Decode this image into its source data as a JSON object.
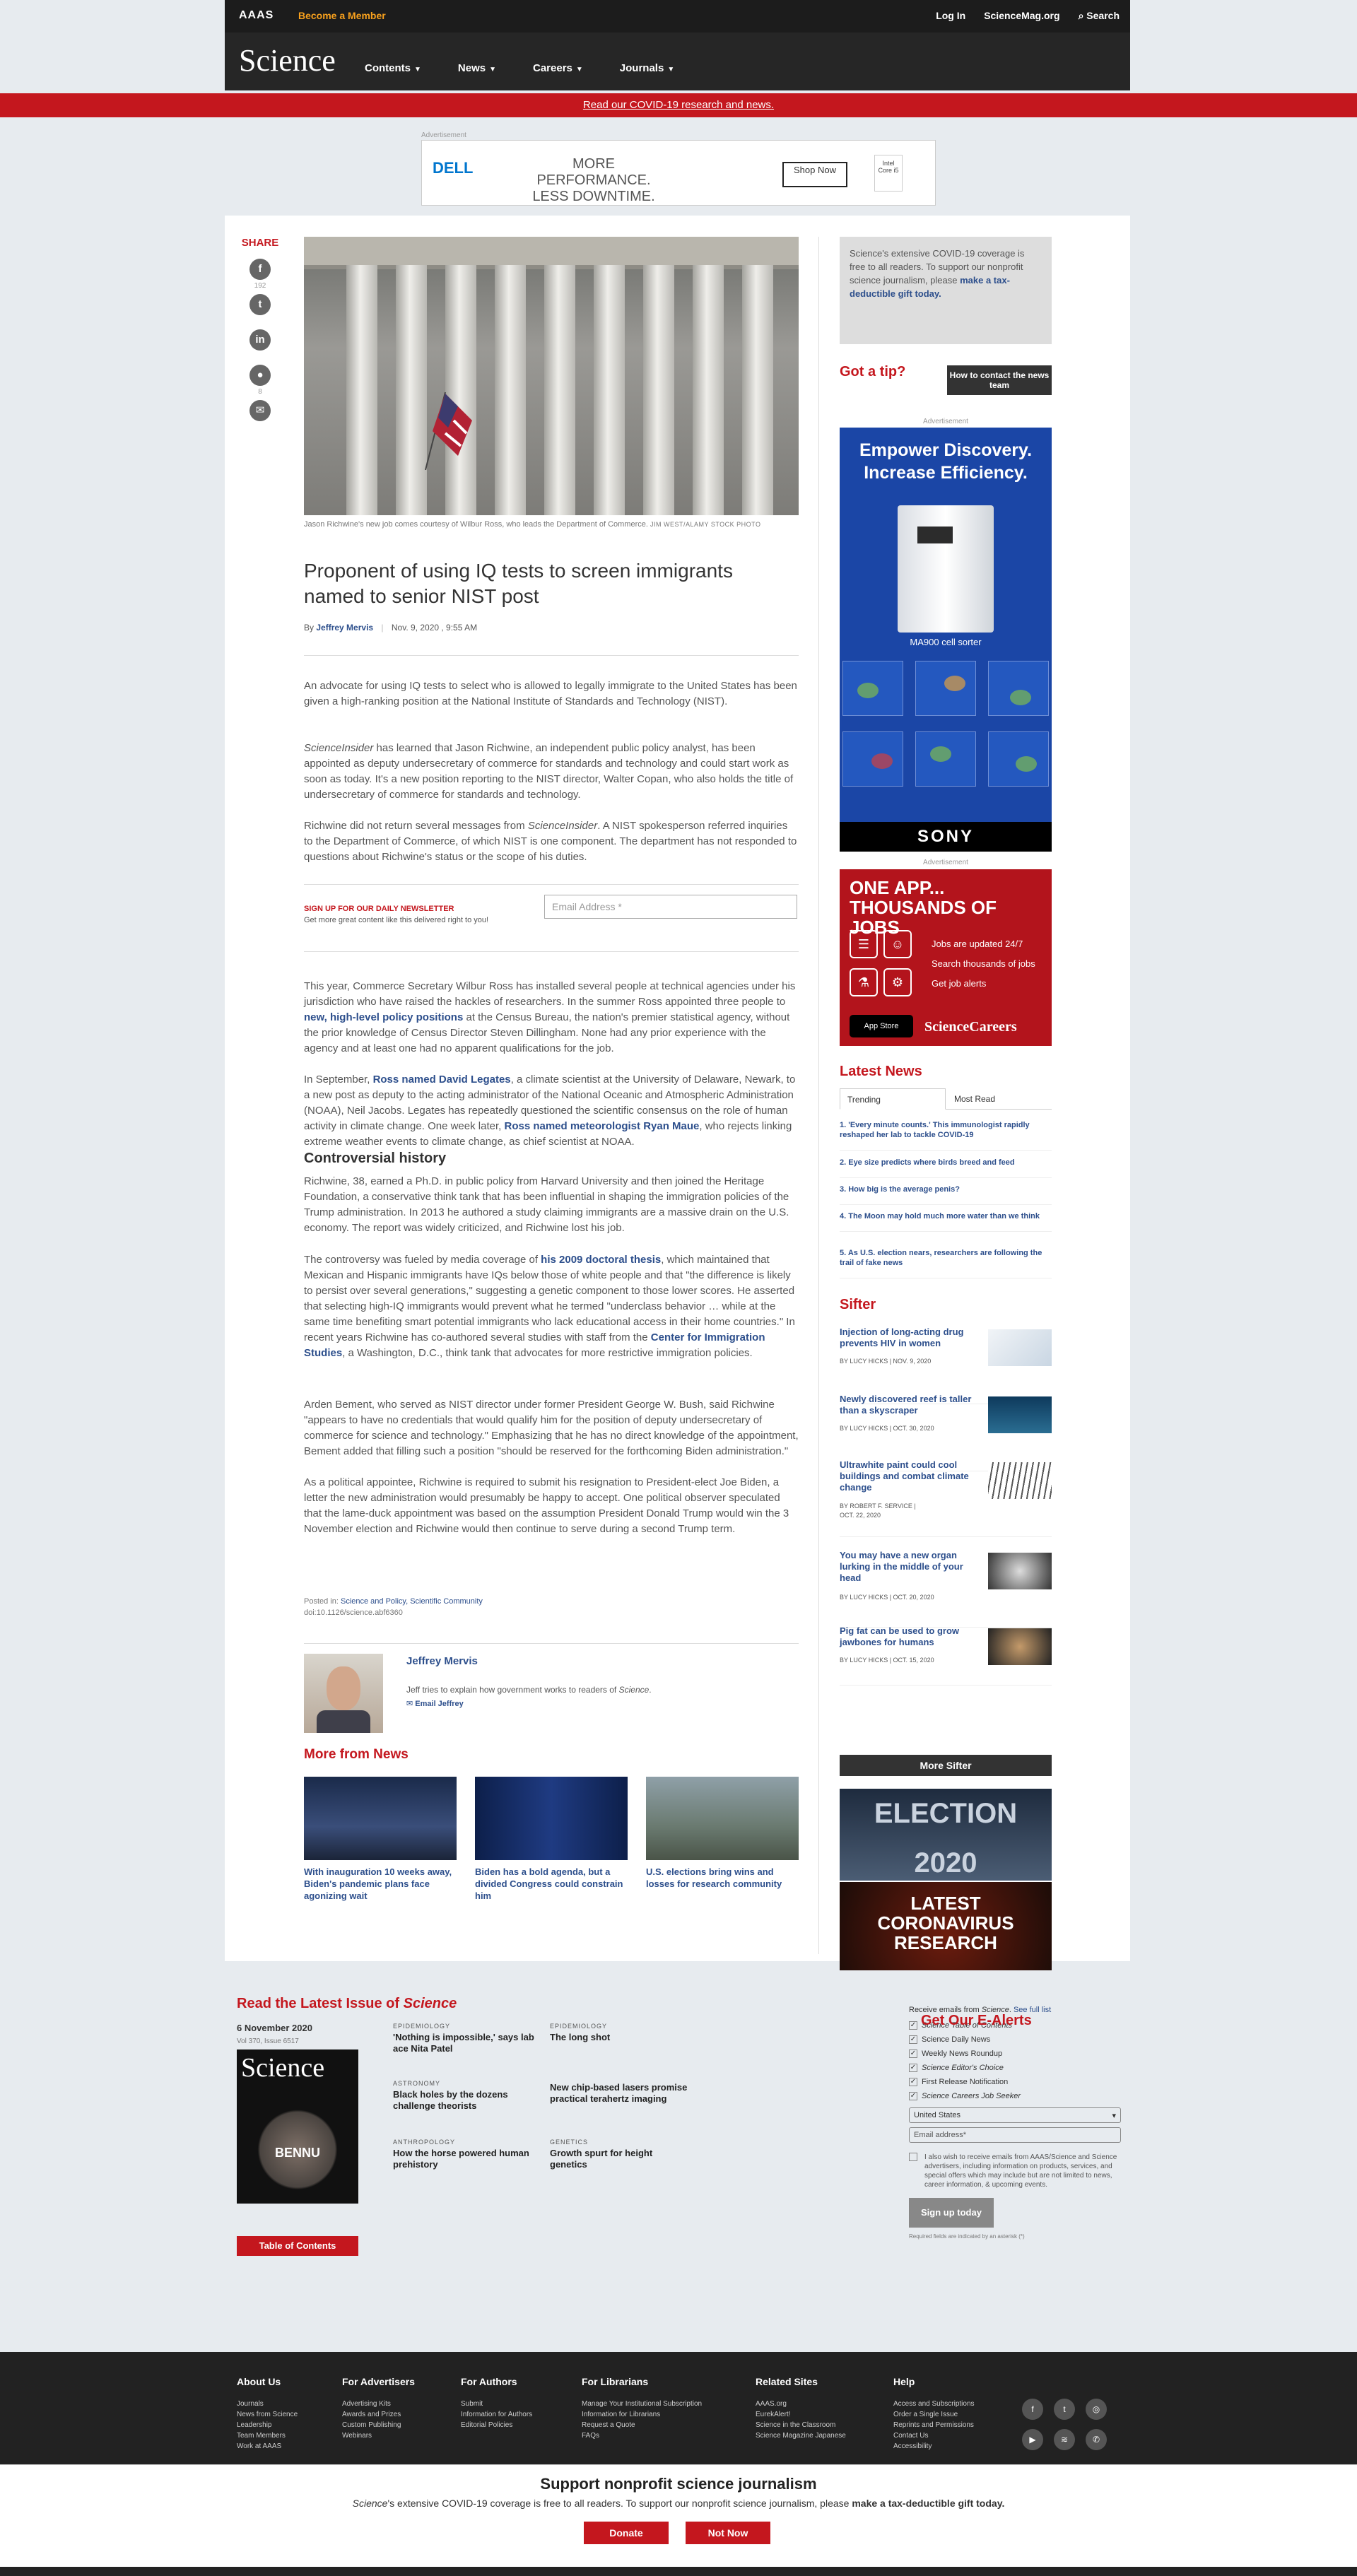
{
  "topbar": {
    "org": "AAAS",
    "become": "Become a Member",
    "login": "Log In",
    "site": "ScienceMag.org",
    "search": "Search"
  },
  "nav": {
    "logo": "Science",
    "items": [
      "Contents",
      "News",
      "Careers",
      "Journals"
    ]
  },
  "covid_banner": "Read our COVID-19 research and news.",
  "top_ad": {
    "label": "Advertisement",
    "brand": "DELL",
    "brand_sub": "Technologies",
    "message": "MORE PERFORMANCE. LESS DOWNTIME.",
    "button": "Shop Now",
    "badge": "Intel Core i5"
  },
  "share": {
    "label": "SHARE",
    "counts": [
      "192",
      "",
      "",
      "8",
      ""
    ]
  },
  "hero": {
    "caption": "Jason Richwine's new job comes courtesy of Wilbur Ross, who leads the Department of Commerce.",
    "credit": "JIM WEST/ALAMY STOCK PHOTO"
  },
  "article": {
    "title": "Proponent of using IQ tests to screen immigrants named to senior NIST post",
    "by": "By",
    "author": "Jeffrey Mervis",
    "date": "Nov. 9, 2020 , 9:55 AM",
    "p1": "An advocate for using IQ tests to select who is allowed to legally immigrate to the United States has been given a high-ranking position at the National Institute of Standards and Technology (NIST).",
    "p2a": "ScienceInsider",
    "p2b": " has learned that Jason Richwine, an independent public policy analyst, has been appointed as deputy undersecretary of commerce for standards and technology and could start work as soon as today. It's a new position reporting to the NIST director, Walter Copan, who also holds the title of undersecretary of commerce for standards and technology.",
    "p3a": "Richwine did not return several messages from ",
    "p3b": "ScienceInsider",
    "p3c": ". A NIST spokesperson referred inquiries to the Department of Commerce, of which NIST is one component. The department has not responded to questions about Richwine's status or the scope of his duties.",
    "p4a": "This year, Commerce Secretary Wilbur Ross has installed several people at technical agencies under his jurisdiction who have raised the hackles of researchers. In the summer Ross appointed three people to ",
    "p4link": "new, high-level policy positions",
    "p4b": " at the Census Bureau, the nation's premier statistical agency, without the prior knowledge of Census Director Steven Dillingham. None had any prior experience with the agency and at least one had no apparent qualifications for the job.",
    "p5a": "In September, ",
    "p5link1": "Ross named David Legates",
    "p5b": ", a climate scientist at the University of Delaware, Newark, to a new post as deputy to the acting administrator of the National Oceanic and Atmospheric Administration (NOAA), Neil Jacobs. Legates has repeatedly questioned the scientific consensus on the role of human activity in climate change. One week later, ",
    "p5link2": "Ross named meteorologist Ryan Maue",
    "p5c": ", who rejects linking extreme weather events to climate change, as chief scientist at NOAA.",
    "sub1": "Controversial history",
    "p6": "Richwine, 38, earned a Ph.D. in public policy from Harvard University and then joined the Heritage Foundation, a conservative think tank that has been influential in shaping the immigration policies of the Trump administration. In 2013 he authored a study claiming immigrants are a massive drain on the U.S. economy. The report was widely criticized, and Richwine lost his job.",
    "p7a": "The controversy was fueled by media coverage of ",
    "p7link1": "his 2009 doctoral thesis",
    "p7b": ", which maintained that Mexican and Hispanic immigrants have IQs below those of white people and that \"the difference is likely to persist over several generations,\" suggesting a genetic component to those lower scores. He asserted that selecting high-IQ immigrants would prevent what he termed \"underclass behavior … while at the same time benefiting smart potential immigrants who lack educational access in their home countries.\" In recent years Richwine has co-authored several studies with staff from the ",
    "p7link2": "Center for Immigration Studies",
    "p7c": ", a Washington, D.C., think tank that advocates for more restrictive immigration policies.",
    "p8": "Arden Bement, who served as NIST director under former President George W. Bush, said Richwine \"appears to have no credentials that would qualify him for the position of deputy undersecretary of commerce for science and technology.\" Emphasizing that he has no direct knowledge of the appointment, Bement added that filling such a position \"should be reserved for the forthcoming Biden administration.\"",
    "p9": "As a political appointee, Richwine is required to submit his resignation to President-elect Joe Biden, a letter the new administration would presumably be happy to accept. One political observer speculated that the lame-duck appointment was based on the assumption President Donald Trump would win the 3 November election and Richwine would then continue to serve during a second Trump term.",
    "posted_in": "Posted in:",
    "categories": "Science and Policy, Scientific Community",
    "doi": "doi:10.1126/science.abf6360"
  },
  "newsletter": {
    "title": "SIGN UP FOR OUR DAILY NEWSLETTER",
    "sub": "Get more great content like this delivered right to you!",
    "placeholder": "Email Address *"
  },
  "author_box": {
    "name": "Jeffrey Mervis",
    "desc_a": "Jeff tries to explain how government works to readers of ",
    "desc_b": "Science",
    "desc_c": ".",
    "email": "Email Jeffrey"
  },
  "more_news": {
    "heading": "More from News",
    "items": [
      "With inauguration 10 weeks away, Biden's pandemic plans face agonizing wait",
      "Biden has a bold agenda, but a divided Congress could constrain him",
      "U.S. elections bring wins and losses for research community"
    ]
  },
  "sidebar": {
    "donate_a": "Science's extensive COVID-19 coverage is free to all readers. To support our nonprofit science journalism, please ",
    "donate_link": "make a tax-deductible gift today.",
    "tip": "Got a tip?",
    "tip_btn": "How to contact the news team",
    "ad_label": "Advertisement",
    "sony_headline": "Empower Discovery. Increase Efficiency.",
    "sony_product": "MA900 cell sorter",
    "sony_brand": "SONY",
    "careers_headline_1": "ONE APP...",
    "careers_headline_2": "THOUSANDS OF JOBS",
    "careers_items": [
      "Jobs are updated 24/7",
      "Search thousands of jobs",
      "Get job alerts"
    ],
    "careers_store": "App Store",
    "careers_brand": "ScienceCareers",
    "latest_news": "Latest News",
    "tab_trending": "Trending",
    "tab_mostread": "Most Read",
    "trending": [
      "1. 'Every minute counts.' This immunologist rapidly reshaped her lab to tackle COVID-19",
      "2. Eye size predicts where birds breed and feed",
      "3. How big is the average penis?",
      "4. The Moon may hold much more water than we think",
      "5. As U.S. election nears, researchers are following the trail of fake news"
    ],
    "sifter": "Sifter",
    "sifter_items": [
      {
        "title": "Injection of long-acting drug prevents HIV in women",
        "by": "BY LUCY HICKS",
        "date": "NOV. 9, 2020"
      },
      {
        "title": "Newly discovered reef is taller than a skyscraper",
        "by": "BY LUCY HICKS",
        "date": "OCT. 30, 2020"
      },
      {
        "title": "Ultrawhite paint could cool buildings and combat climate change",
        "by": "BY ROBERT F. SERVICE",
        "date": "OCT. 22, 2020"
      },
      {
        "title": "You may have a new organ lurking in the middle of your head",
        "by": "BY LUCY HICKS",
        "date": "OCT. 20, 2020"
      },
      {
        "title": "Pig fat can be used to grow jawbones for humans",
        "by": "BY LUCY HICKS",
        "date": "OCT. 15, 2020"
      }
    ],
    "more_sifter": "More Sifter",
    "election": "ELECTION 2020",
    "corona_1": "LATEST",
    "corona_2": "CORONAVIRUS",
    "corona_3": "RESEARCH"
  },
  "latest_issue": {
    "heading_a": "Read the Latest Issue of ",
    "heading_b": "Science",
    "date": "6 November 2020",
    "vol": "Vol 370, Issue 6517",
    "cover_title": "Science",
    "cover_word": "BENNU",
    "toc": "Table of Contents",
    "items": [
      {
        "cat": "EPIDEMIOLOGY",
        "title": "'Nothing is impossible,' says lab ace Nita Patel"
      },
      {
        "cat": "EPIDEMIOLOGY",
        "title": "The long shot"
      },
      {
        "cat": "ASTRONOMY",
        "title": "Black holes by the dozens challenge theorists"
      },
      {
        "cat": "",
        "title": "New chip-based lasers promise practical terahertz imaging"
      },
      {
        "cat": "ANTHROPOLOGY",
        "title": "How the horse powered human prehistory"
      },
      {
        "cat": "GENETICS",
        "title": "Growth spurt for height genetics"
      }
    ]
  },
  "alerts": {
    "heading": "Get Our E-Alerts",
    "receive_a": "Receive emails from ",
    "receive_b": "Science",
    "receive_c": ". ",
    "see_full": "See full list",
    "options": [
      "Science Table of Contents",
      "Science Daily News",
      "Weekly News Roundup",
      "Science Editor's Choice",
      "First Release Notification",
      "Science Careers Job Seeker"
    ],
    "country": "United States",
    "email_placeholder": "Email address*",
    "fine": "I also wish to receive emails from AAAS/Science and Science advertisers, including information on products, services, and special offers which may include but are not limited to news, career information, & upcoming events.",
    "signup": "Sign up today",
    "required": "Required fields are indicated by an asterisk (*)"
  },
  "footer": {
    "cols": [
      {
        "h": "About Us",
        "items": [
          "Journals",
          "News from Science",
          "Leadership",
          "Team Members",
          "Work at AAAS"
        ]
      },
      {
        "h": "For Advertisers",
        "items": [
          "Advertising Kits",
          "Awards and Prizes",
          "Custom Publishing",
          "Webinars"
        ]
      },
      {
        "h": "For Authors",
        "items": [
          "Submit",
          "Information for Authors",
          "Editorial Policies"
        ]
      },
      {
        "h": "For Librarians",
        "items": [
          "Manage Your Institutional Subscription",
          "Information for Librarians",
          "Request a Quote",
          "FAQs"
        ]
      },
      {
        "h": "Related Sites",
        "items": [
          "AAAS.org",
          "EurekAlert!",
          "Science in the Classroom",
          "Science Magazine Japanese"
        ]
      },
      {
        "h": "Help",
        "items": [
          "Access and Subscriptions",
          "Order a Single Issue",
          "Reprints and Permissions",
          "Contact Us",
          "Accessibility"
        ]
      }
    ]
  },
  "support": {
    "heading": "Support nonprofit science journalism",
    "text_a": "Science",
    "text_b": "'s extensive COVID-19 coverage is free to all readers. To support our nonprofit science journalism, please ",
    "text_c": "make a tax-deductible gift today.",
    "donate": "Donate",
    "not_now": "Not Now"
  },
  "colors": {
    "brand_red": "#c4171e",
    "link_blue": "#2d4f8c",
    "dark": "#262626"
  }
}
